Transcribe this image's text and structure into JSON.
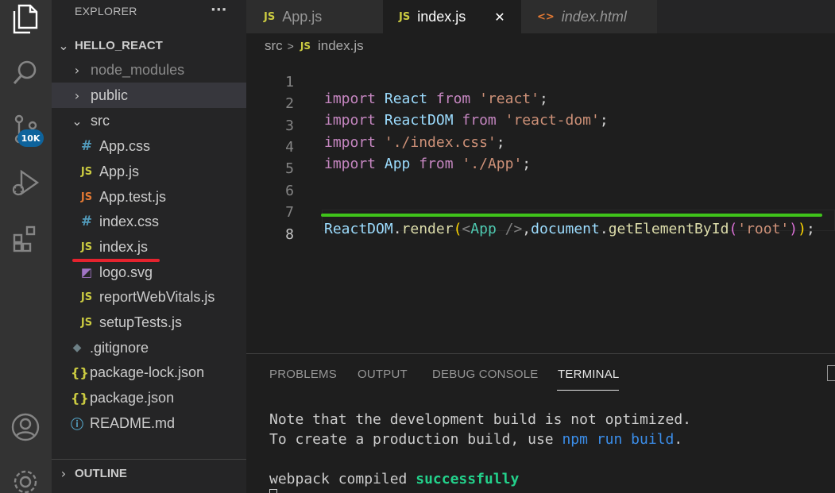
{
  "explorer": {
    "title": "EXPLORER",
    "more": "···",
    "project": "HELLO_REACT",
    "items": [
      {
        "label": "node_modules",
        "icon": "chevron-right"
      },
      {
        "label": "public",
        "icon": "chevron-right"
      },
      {
        "label": "src",
        "icon": "chevron-down"
      },
      {
        "label": "App.css",
        "icon": "#"
      },
      {
        "label": "App.js",
        "icon": "JS"
      },
      {
        "label": "App.test.js",
        "icon": "JS"
      },
      {
        "label": "index.css",
        "icon": "#"
      },
      {
        "label": "index.js",
        "icon": "JS"
      },
      {
        "label": "logo.svg",
        "icon": "svg-icon"
      },
      {
        "label": "reportWebVitals.js",
        "icon": "JS"
      },
      {
        "label": "setupTests.js",
        "icon": "JS"
      },
      {
        "label": ".gitignore",
        "icon": "git-icon"
      },
      {
        "label": "package-lock.json",
        "icon": "{}"
      },
      {
        "label": "package.json",
        "icon": "{}"
      },
      {
        "label": "README.md",
        "icon": "info-icon"
      }
    ],
    "outline": "OUTLINE"
  },
  "activity": {
    "badge": "10K"
  },
  "tabs": [
    {
      "icon": "JS",
      "label": "App.js"
    },
    {
      "icon": "JS",
      "label": "index.js",
      "close": "✕"
    },
    {
      "icon": "<>",
      "label": "index.html"
    }
  ],
  "breadcrumb": {
    "folder": "src",
    "sep": ">",
    "icon": "JS",
    "file": "index.js"
  },
  "editor": {
    "line_numbers": [
      "1",
      "2",
      "3",
      "4",
      "5",
      "6",
      "7",
      "8"
    ],
    "l1": {
      "kw1": "import",
      "id": "React",
      "kw2": "from",
      "str": "'react'",
      "end": ";"
    },
    "l2": {
      "kw1": "import",
      "id": "ReactDOM",
      "kw2": "from",
      "str": "'react-dom'",
      "end": ";"
    },
    "l3": {
      "kw1": "import",
      "str": "'./index.css'",
      "end": ";"
    },
    "l4": {
      "kw1": "import",
      "id": "App",
      "kw2": "from",
      "str": "'./App'",
      "end": ";"
    },
    "l7": {
      "obj": "ReactDOM",
      "dot1": ".",
      "fn1": "render",
      "p1": "(",
      "lt": "<",
      "tag": "App",
      "slashgt": " />",
      "comma": ",",
      "obj2": "document",
      "dot2": ".",
      "fn2": "getElementById",
      "p2": "(",
      "str": "'root'",
      "p3": ")",
      "p4": ")",
      "end": ";"
    }
  },
  "panel": {
    "tabs": [
      "PROBLEMS",
      "OUTPUT",
      "DEBUG CONSOLE",
      "TERMINAL"
    ],
    "terminal": {
      "line1": "Note that the development build is not optimized.",
      "line2_a": "To create a production build, use ",
      "line2_b": "npm run build",
      "line2_c": ".",
      "line3_a": "webpack compiled ",
      "line3_b": "successfully"
    }
  },
  "colors": {
    "annotation_red": "#e5232e",
    "annotation_green": "#3fc31a"
  }
}
